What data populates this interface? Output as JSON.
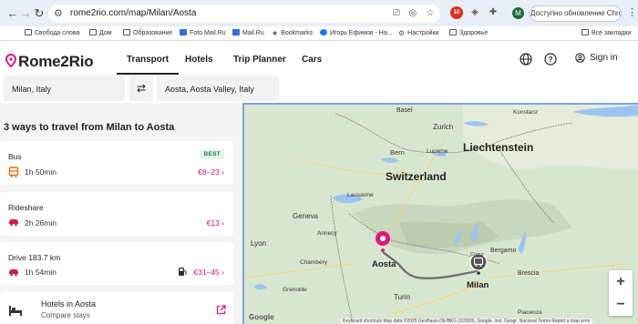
{
  "browser": {
    "url": "rome2rio.com/map/Milan/Aosta",
    "profile_initial": "M",
    "update_button": "Доступно обновление Chrome",
    "extension_badge": "10",
    "bookmarks": [
      {
        "label": "Свобода слова",
        "icon": "folder"
      },
      {
        "label": "Дом",
        "icon": "folder"
      },
      {
        "label": "Образование",
        "icon": "folder"
      },
      {
        "label": "Foto.Mail.Ru",
        "icon": "mail-ru"
      },
      {
        "label": "Mail.Ru",
        "icon": "mail-ru"
      },
      {
        "label": "Bookmarks",
        "icon": "star"
      },
      {
        "label": "Игорь Ефимов - На...",
        "icon": "facebook"
      },
      {
        "label": "Настройки",
        "icon": "settings"
      },
      {
        "label": "Здоровье",
        "icon": "folder"
      },
      {
        "label": "Все закладки",
        "icon": "folder"
      }
    ]
  },
  "site": {
    "logo": "Rome2Rio",
    "brand_color": "#e0187d",
    "nav": [
      "Transport",
      "Hotels",
      "Trip Planner",
      "Cars"
    ],
    "active_nav": "Transport",
    "sign_in": "Sign in"
  },
  "search": {
    "from": "Milan, Italy",
    "to": "Aosta, Aosta Valley, Italy"
  },
  "results": {
    "title": "3 ways to travel from Milan to Aosta",
    "routes": [
      {
        "mode": "Bus",
        "duration": "1h 50min",
        "price": "€8–23",
        "badge": "BEST",
        "icon": "bus-icon"
      },
      {
        "mode": "Rideshare",
        "duration": "2h 26min",
        "price": "€13",
        "icon": "car-icon"
      },
      {
        "mode": "Drive 183.7 km",
        "duration": "1h 54min",
        "price": "€31–45",
        "icon": "car-icon",
        "extra_icon": "fuel-icon"
      }
    ],
    "hotels": {
      "title": "Hotels in Aosta",
      "subtitle": "Compare stays"
    }
  },
  "map": {
    "labels": {
      "liechtenstein": "Liechtenstein",
      "switzerland": "Switzerland",
      "basel": "Basel",
      "zurich": "Zurich",
      "bern": "Bern",
      "lausanne": "Lausanne",
      "geneva": "Geneva",
      "lyon": "Lyon",
      "aosta": "Aosta",
      "milan": "Milan",
      "turin": "Turin",
      "bergamo": "Bergamo",
      "brescia": "Brescia",
      "chambery": "Chambéry",
      "grenoble": "Grenoble",
      "annecy": "Annecy",
      "piacenza": "Piacenza",
      "como": "Como",
      "lucerne": "Lucerne",
      "konstanz": "Konstanz"
    },
    "zoom_in": "+",
    "zoom_out": "−",
    "google": "Google",
    "footer": "Keyboard shortcuts     Map data ©2025 GeoBasis-DE/BKG (©2009), Google, Inst. Geogr. Nacional     Terms     Report a map error"
  }
}
